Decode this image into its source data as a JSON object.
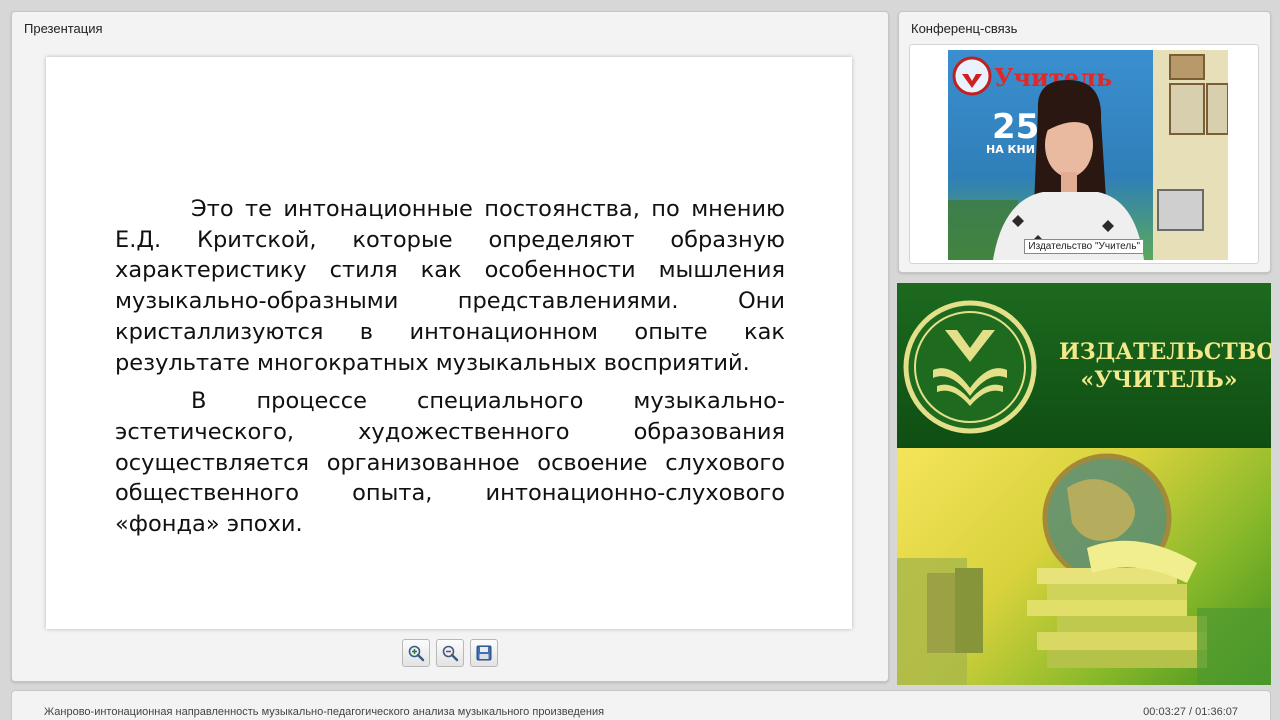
{
  "presentation": {
    "title": "Презентация",
    "slide": {
      "paragraphs": [
        "Это те интонационные постоянства, по мнению Е.Д. Критской, которые определяют образную характеристику стиля как особенности мышления музыкально-образными представлениями. Они кристаллизуются в интонационном опыте как результате многократных музыкальных восприятий.",
        "В процессе специального музыкально-эстетического, художественного образования осуществляется организованное освоение слухового общественного опыта, интонационно-слухового «фонда» эпохи."
      ]
    },
    "toolbar": {
      "zoom_in_icon": "zoom-in-icon",
      "zoom_out_icon": "zoom-out-icon",
      "save_icon": "save-icon"
    }
  },
  "conference": {
    "title": "Конференц-связь",
    "video": {
      "poster_brand": "Учитель",
      "poster_number": "25",
      "poster_caption": "НА КНИ",
      "speaker_label": "Издательство \"Учитель\""
    }
  },
  "banner": {
    "publisher_line1": "ИЗДАТЕЛЬСТВО",
    "publisher_line2": "«УЧИТЕЛЬ»"
  },
  "status_bar": {
    "lecture_title": "Жанрово-интонационная направленность музыкально-педагогического анализа музыкального произведения",
    "elapsed": "00:03:27",
    "total": "01:36:07",
    "separator": " / "
  },
  "colors": {
    "banner_green": "#1d6a1f",
    "banner_text": "#f2e98a",
    "panel_bg": "#f3f3f3"
  }
}
